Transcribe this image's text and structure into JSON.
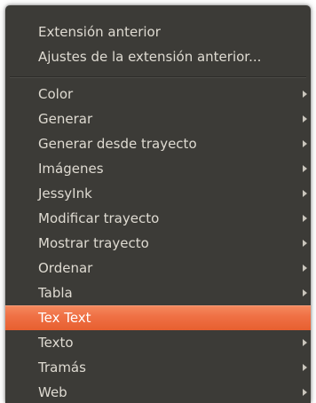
{
  "menu": {
    "top_items": [
      {
        "label": "Extensión anterior"
      },
      {
        "label": "Ajustes de la extensión anterior..."
      }
    ],
    "items": [
      {
        "label": "Color",
        "has_submenu": true
      },
      {
        "label": "Generar",
        "has_submenu": true
      },
      {
        "label": "Generar desde trayecto",
        "has_submenu": true
      },
      {
        "label": "Imágenes",
        "has_submenu": true
      },
      {
        "label": "JessyInk",
        "has_submenu": true
      },
      {
        "label": "Modificar trayecto",
        "has_submenu": true
      },
      {
        "label": "Mostrar trayecto",
        "has_submenu": true
      },
      {
        "label": "Ordenar",
        "has_submenu": true
      },
      {
        "label": "Tabla",
        "has_submenu": true
      },
      {
        "label": "Tex Text",
        "has_submenu": false,
        "highlighted": true
      },
      {
        "label": "Texto",
        "has_submenu": true
      },
      {
        "label": "Tramás",
        "has_submenu": true
      },
      {
        "label": "Web",
        "has_submenu": true
      }
    ],
    "submenu_arrow_icon": "chevron-right-icon",
    "colors": {
      "background": "#3c3b37",
      "text": "#dfdbd2",
      "highlight": "#ef7044",
      "highlight_text": "#ffffff"
    }
  }
}
